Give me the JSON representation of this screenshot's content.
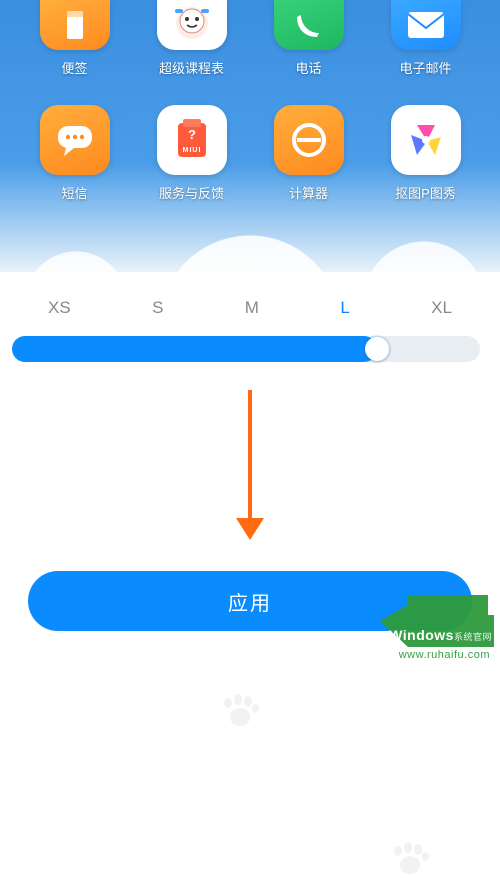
{
  "apps": {
    "row1": [
      {
        "label": "便签",
        "name": "notes-app",
        "icon": "notes-icon",
        "bg": "ic-orange"
      },
      {
        "label": "超级课程表",
        "name": "schedule-app",
        "icon": "schedule-icon",
        "bg": "ic-white"
      },
      {
        "label": "电话",
        "name": "phone-app",
        "icon": "phone-icon",
        "bg": "ic-green"
      },
      {
        "label": "电子邮件",
        "name": "email-app",
        "icon": "email-icon",
        "bg": "ic-blue"
      }
    ],
    "row2": [
      {
        "label": "短信",
        "name": "messages-app",
        "icon": "messages-icon",
        "bg": "ic-orange"
      },
      {
        "label": "服务与反馈",
        "name": "feedback-app",
        "icon": "feedback-icon",
        "bg": "ic-white"
      },
      {
        "label": "计算器",
        "name": "calc-app",
        "icon": "calc-icon",
        "bg": "ic-orange"
      },
      {
        "label": "抠图P图秀",
        "name": "photo-app",
        "icon": "photo-icon",
        "bg": "ic-white"
      }
    ]
  },
  "sizes": {
    "options": [
      "XS",
      "S",
      "M",
      "L",
      "XL"
    ],
    "selected_index": 3
  },
  "slider": {
    "value_percent": 78
  },
  "apply_button": {
    "label": "应用"
  },
  "colors": {
    "accent": "#0a8cff",
    "brand": "#2e9a3d",
    "arrow": "#ff6a13"
  },
  "watermark": {
    "brand_prefix": "W",
    "brand_text": "indows",
    "brand_suffix": "系统官网",
    "url": "www.ruhaifu.com"
  }
}
